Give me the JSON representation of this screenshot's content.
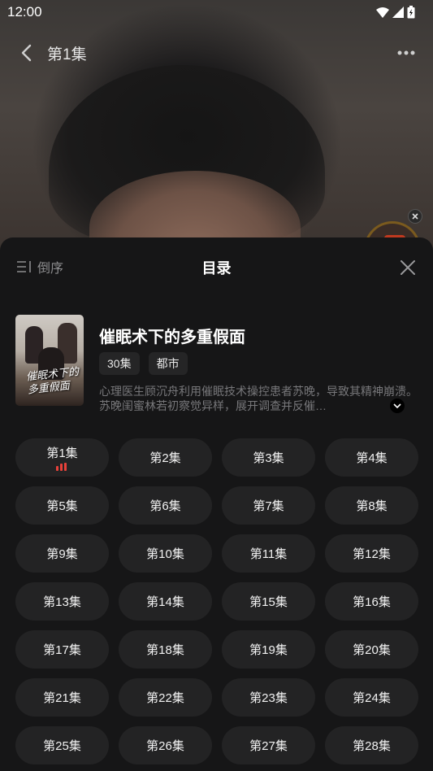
{
  "status_bar": {
    "time": "12:00"
  },
  "nav": {
    "title": "第1集"
  },
  "sheet": {
    "sort_label": "倒序",
    "title": "目录"
  },
  "drama": {
    "title": "催眠术下的多重假面",
    "poster_text": "催眠术下的多重假面",
    "tags": [
      "30集",
      "都市"
    ],
    "synopsis": "心理医生顾沉舟利用催眠技术操控患者苏晚，导致其精神崩溃。苏晚闺蜜林若初察觉异样，展开调查并反催…"
  },
  "episodes": {
    "current_index": 0,
    "labels": [
      "第1集",
      "第2集",
      "第3集",
      "第4集",
      "第5集",
      "第6集",
      "第7集",
      "第8集",
      "第9集",
      "第10集",
      "第11集",
      "第12集",
      "第13集",
      "第14集",
      "第15集",
      "第16集",
      "第17集",
      "第18集",
      "第19集",
      "第20集",
      "第21集",
      "第22集",
      "第23集",
      "第24集",
      "第25集",
      "第26集",
      "第27集",
      "第28集"
    ]
  },
  "colors": {
    "sheet_bg": "#161617",
    "episode_btn_bg": "#232324",
    "playing_accent": "#e8413a"
  }
}
